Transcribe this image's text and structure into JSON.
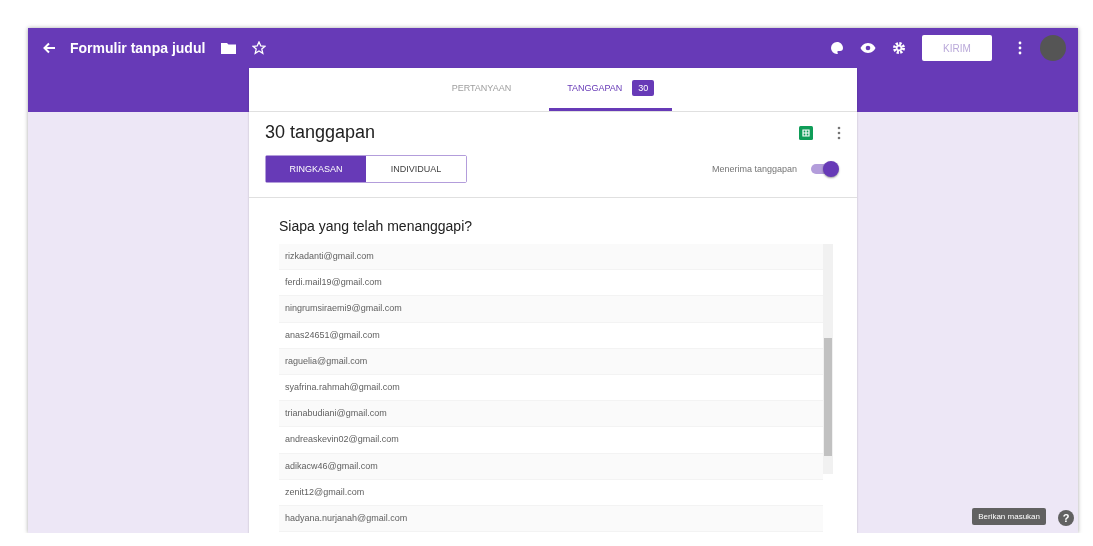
{
  "header": {
    "title": "Formulir tanpa judul",
    "send_button": "KIRIM"
  },
  "tabs": [
    {
      "label": "PERTANYAAN",
      "selected": false
    },
    {
      "label": "TANGGAPAN",
      "selected": true,
      "badge": "30"
    }
  ],
  "summary": {
    "count_title": "30 tanggapan",
    "views": [
      {
        "label": "RINGKASAN",
        "selected": true
      },
      {
        "label": "INDIVIDUAL",
        "selected": false
      }
    ],
    "accepting": {
      "label": "Menerima tanggapan",
      "on": true
    }
  },
  "respondents": {
    "question": "Siapa yang telah menanggapi?",
    "emails": [
      "rizkadanti@gmail.com",
      "ferdi.mail19@gmail.com",
      "ningrumsiraemi9@gmail.com",
      "anas24651@gmail.com",
      "raguelia@gmail.com",
      "syafrina.rahmah@gmail.com",
      "trianabudiani@gmail.com",
      "andreaskevin02@gmail.com",
      "adikacw46@gmail.com",
      "zenit12@gmail.com",
      "hadyana.nurjanah@gmail.com"
    ]
  },
  "feedback_button": "Berikan masukan",
  "help_button": "?"
}
